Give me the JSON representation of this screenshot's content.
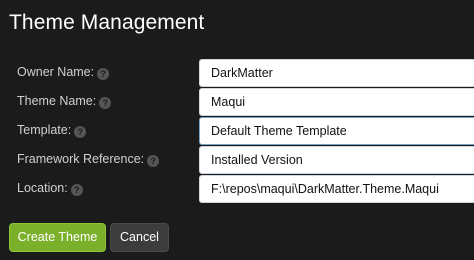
{
  "page": {
    "title": "Theme Management"
  },
  "form": {
    "fields": [
      {
        "label": "Owner Name:",
        "value": "DarkMatter",
        "help_icon": "question-circle-icon"
      },
      {
        "label": "Theme Name:",
        "value": "Maqui",
        "help_icon": "question-circle-icon"
      },
      {
        "label": "Template:",
        "value": "Default Theme Template",
        "help_icon": "question-circle-icon"
      },
      {
        "label": "Framework Reference:",
        "value": "Installed Version",
        "help_icon": "question-circle-icon"
      },
      {
        "label": "Location:",
        "value": "F:\\repos\\maqui\\DarkMatter.Theme.Maqui",
        "help_icon": "question-circle-icon"
      }
    ],
    "help_glyph": "?"
  },
  "actions": {
    "create_label": "Create Theme",
    "cancel_label": "Cancel"
  },
  "colors": {
    "background": "#1b1b1b",
    "primary_button": "#7bb02b",
    "secondary_button": "#3c3c3c"
  }
}
